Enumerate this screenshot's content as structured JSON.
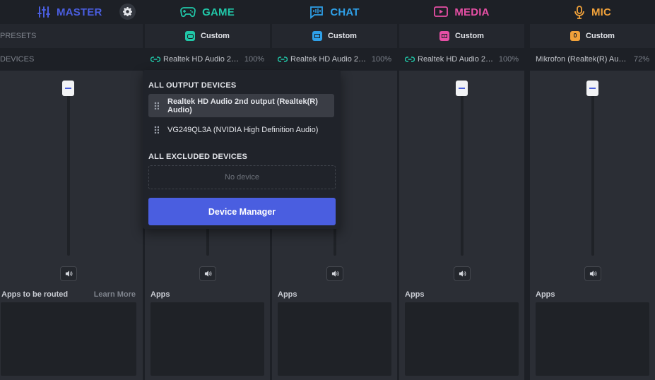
{
  "channels": [
    {
      "id": "master",
      "title": "MASTER",
      "color": "#4a5ee0",
      "icon": "sliders-icon"
    },
    {
      "id": "game",
      "title": "GAME",
      "color": "#21c7a8",
      "icon": "gamepad-icon",
      "preset": "Custom",
      "device": "Realtek HD Audio 2n...",
      "volume": "100%",
      "apps_label": "Apps"
    },
    {
      "id": "chat",
      "title": "CHAT",
      "color": "#2fa0e8",
      "icon": "chat-waveform-icon",
      "preset": "Custom",
      "device": "Realtek HD Audio 2n...",
      "volume": "100%",
      "apps_label": "Apps"
    },
    {
      "id": "media",
      "title": "MEDIA",
      "color": "#e64fa5",
      "icon": "play-screen-icon",
      "preset": "Custom",
      "device": "Realtek HD Audio 2n...",
      "volume": "100%",
      "apps_label": "Apps"
    },
    {
      "id": "mic",
      "title": "MIC",
      "color": "#f0a13a",
      "icon": "microphone-icon",
      "preset": "Custom",
      "device": "Mikrofon (Realtek(R) Audi...",
      "volume": "72%",
      "apps_label": "Apps"
    }
  ],
  "master": {
    "presets_label": "PRESETS",
    "devices_label": "DEVICES",
    "apps_label": "Apps to be routed",
    "learn_more": "Learn More"
  },
  "dropdown": {
    "output_header": "ALL OUTPUT DEVICES",
    "outputs": [
      {
        "label": "Realtek HD Audio 2nd output (Realtek(R) Audio)",
        "selected": true
      },
      {
        "label": "VG249QL3A (NVIDIA High Definition Audio)",
        "selected": false
      }
    ],
    "excluded_header": "ALL EXCLUDED DEVICES",
    "no_device": "No device",
    "button": "Device Manager"
  }
}
